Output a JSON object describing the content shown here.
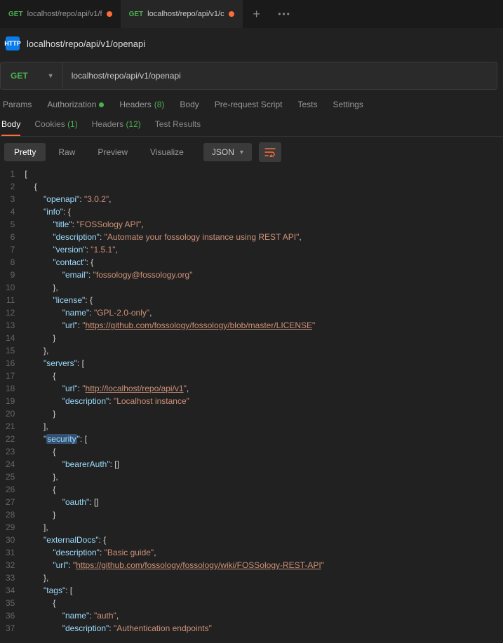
{
  "tabs": [
    {
      "method": "GET",
      "label": "localhost/repo/api/v1/f"
    },
    {
      "method": "GET",
      "label": "localhost/repo/api/v1/c"
    }
  ],
  "title": {
    "badge": "HTTP",
    "text": "localhost/repo/api/v1/openapi"
  },
  "request": {
    "method": "GET",
    "url": "localhost/repo/api/v1/openapi"
  },
  "req_tabs": {
    "params": "Params",
    "auth": "Authorization",
    "headers": "Headers",
    "headers_count": "(8)",
    "body": "Body",
    "pre": "Pre-request Script",
    "tests": "Tests",
    "settings": "Settings"
  },
  "resp_tabs": {
    "body": "Body",
    "cookies": "Cookies",
    "cookies_count": "(1)",
    "headers": "Headers",
    "headers_count": "(12)",
    "test": "Test Results"
  },
  "toolbar": {
    "pretty": "Pretty",
    "raw": "Raw",
    "preview": "Preview",
    "visualize": "Visualize",
    "json": "JSON"
  },
  "code_lines": [
    {
      "n": 1,
      "html": "["
    },
    {
      "n": 2,
      "html": "    {"
    },
    {
      "n": 3,
      "html": "        <span class='key'>\"openapi\"</span><span class='pun'>:</span> <span class='str'>\"3.0.2\"</span><span class='pun'>,</span>"
    },
    {
      "n": 4,
      "html": "        <span class='key'>\"info\"</span><span class='pun'>:</span> <span class='pun'>{</span>"
    },
    {
      "n": 5,
      "html": "            <span class='key'>\"title\"</span><span class='pun'>:</span> <span class='str'>\"FOSSology API\"</span><span class='pun'>,</span>"
    },
    {
      "n": 6,
      "html": "            <span class='key'>\"description\"</span><span class='pun'>:</span> <span class='str'>\"Automate your fossology instance using REST API\"</span><span class='pun'>,</span>"
    },
    {
      "n": 7,
      "html": "            <span class='key'>\"version\"</span><span class='pun'>:</span> <span class='str'>\"1.5.1\"</span><span class='pun'>,</span>"
    },
    {
      "n": 8,
      "html": "            <span class='key'>\"contact\"</span><span class='pun'>:</span> <span class='pun'>{</span>"
    },
    {
      "n": 9,
      "html": "                <span class='key'>\"email\"</span><span class='pun'>:</span> <span class='str'>\"fossology@fossology.org\"</span>"
    },
    {
      "n": 10,
      "html": "            <span class='pun'>},</span>"
    },
    {
      "n": 11,
      "html": "            <span class='key'>\"license\"</span><span class='pun'>:</span> <span class='pun'>{</span>"
    },
    {
      "n": 12,
      "html": "                <span class='key'>\"name\"</span><span class='pun'>:</span> <span class='str'>\"GPL-2.0-only\"</span><span class='pun'>,</span>"
    },
    {
      "n": 13,
      "html": "                <span class='key'>\"url\"</span><span class='pun'>:</span> <span class='str'>\"<span class='url-link'>https://github.com/fossology/fossology/blob/master/LICENSE</span>\"</span>"
    },
    {
      "n": 14,
      "html": "            <span class='pun'>}</span>"
    },
    {
      "n": 15,
      "html": "        <span class='pun'>},</span>"
    },
    {
      "n": 16,
      "html": "        <span class='key'>\"servers\"</span><span class='pun'>:</span> <span class='pun'>[</span>"
    },
    {
      "n": 17,
      "html": "            <span class='pun'>{</span>"
    },
    {
      "n": 18,
      "html": "                <span class='key'>\"url\"</span><span class='pun'>:</span> <span class='str'>\"<span class='url-link'>http://localhost/repo/api/v1</span>\"</span><span class='pun'>,</span>"
    },
    {
      "n": 19,
      "html": "                <span class='key'>\"description\"</span><span class='pun'>:</span> <span class='str'>\"Localhost instance\"</span>"
    },
    {
      "n": 20,
      "html": "            <span class='pun'>}</span>"
    },
    {
      "n": 21,
      "html": "        <span class='pun'>],</span>"
    },
    {
      "n": 22,
      "html": "        <span class='key'>\"<span class='hl'>security</span>\"</span><span class='pun'>:</span> <span class='pun'>[</span>"
    },
    {
      "n": 23,
      "html": "            <span class='pun'>{</span>"
    },
    {
      "n": 24,
      "html": "                <span class='key'>\"bearerAuth\"</span><span class='pun'>:</span> <span class='pun'>[]</span>"
    },
    {
      "n": 25,
      "html": "            <span class='pun'>},</span>"
    },
    {
      "n": 26,
      "html": "            <span class='pun'>{</span>"
    },
    {
      "n": 27,
      "html": "                <span class='key'>\"oauth\"</span><span class='pun'>:</span> <span class='pun'>[]</span>"
    },
    {
      "n": 28,
      "html": "            <span class='pun'>}</span>"
    },
    {
      "n": 29,
      "html": "        <span class='pun'>],</span>"
    },
    {
      "n": 30,
      "html": "        <span class='key'>\"externalDocs\"</span><span class='pun'>:</span> <span class='pun'>{</span>"
    },
    {
      "n": 31,
      "html": "            <span class='key'>\"description\"</span><span class='pun'>:</span> <span class='str'>\"Basic guide\"</span><span class='pun'>,</span>"
    },
    {
      "n": 32,
      "html": "            <span class='key'>\"url\"</span><span class='pun'>:</span> <span class='str'>\"<span class='url-link'>https://github.com/fossology/fossology/wiki/FOSSology-REST-API</span>\"</span>"
    },
    {
      "n": 33,
      "html": "        <span class='pun'>},</span>"
    },
    {
      "n": 34,
      "html": "        <span class='key'>\"tags\"</span><span class='pun'>:</span> <span class='pun'>[</span>"
    },
    {
      "n": 35,
      "html": "            <span class='pun'>{</span>"
    },
    {
      "n": 36,
      "html": "                <span class='key'>\"name\"</span><span class='pun'>:</span> <span class='str'>\"auth\"</span><span class='pun'>,</span>"
    },
    {
      "n": 37,
      "html": "                <span class='key'>\"description\"</span><span class='pun'>:</span> <span class='str'>\"Authentication endpoints\"</span>"
    }
  ]
}
